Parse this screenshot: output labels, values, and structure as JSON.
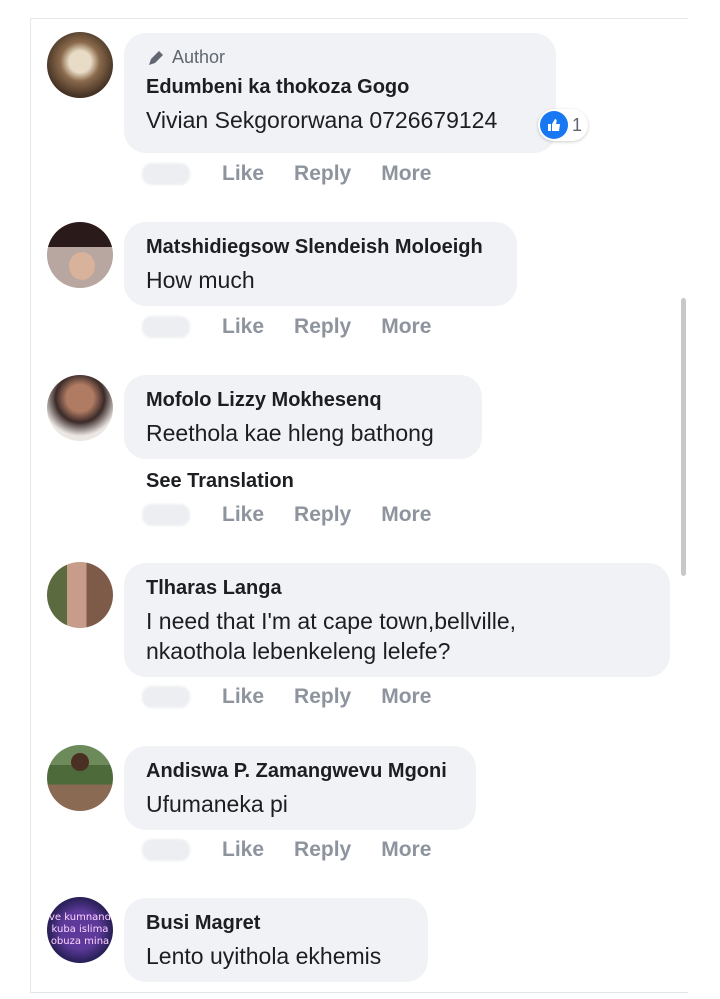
{
  "comments": [
    {
      "badge": "Author",
      "name": "Edumbeni ka thokoza Gogo",
      "text": "Vivian Sekgororwana 0726679124",
      "reaction_count": "1",
      "actions": {
        "like": "Like",
        "reply": "Reply",
        "more": "More"
      }
    },
    {
      "name": "Matshidiegsow Slendeish Moloeigh",
      "text": "How much",
      "actions": {
        "like": "Like",
        "reply": "Reply",
        "more": "More"
      }
    },
    {
      "name": "Mofolo Lizzy Mokhesenq",
      "text": "Reethola kae hleng bathong",
      "see_translation": "See Translation",
      "actions": {
        "like": "Like",
        "reply": "Reply",
        "more": "More"
      }
    },
    {
      "name": "Tlharas Langa",
      "text_lines": [
        "I need that I'm at cape town,bellville,",
        "nkaothola lebenkeleng lelefe?"
      ],
      "actions": {
        "like": "Like",
        "reply": "Reply",
        "more": "More"
      }
    },
    {
      "name": "Andiswa P. Zamangwevu Mgoni",
      "text": "Ufumaneka pi",
      "actions": {
        "like": "Like",
        "reply": "Reply",
        "more": "More"
      }
    },
    {
      "name": "Busi Magret",
      "text": "Lento uyithola ekhemis",
      "avatar_text": "ve kumnand\nkuba islima\nobuza mina"
    }
  ],
  "colors": {
    "bubble": "#f0f2f5",
    "action_text": "#8d949e",
    "like_blue": "#1877f2"
  }
}
